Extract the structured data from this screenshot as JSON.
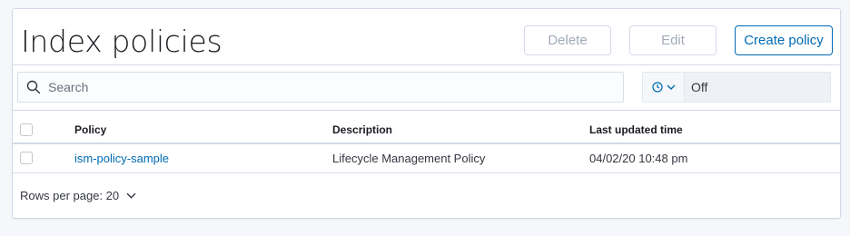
{
  "header": {
    "title": "Index policies",
    "delete_label": "Delete",
    "edit_label": "Edit",
    "create_label": "Create policy"
  },
  "search": {
    "placeholder": "Search",
    "value": ""
  },
  "refresh": {
    "icon": "clock-icon",
    "value": "Off"
  },
  "table": {
    "columns": [
      "Policy",
      "Description",
      "Last updated time"
    ],
    "rows": [
      {
        "policy": "ism-policy-sample",
        "description": "Lifecycle Management Policy",
        "last_updated": "04/02/20 10:48 pm",
        "selected": false
      }
    ]
  },
  "pagination": {
    "rows_per_page_label": "Rows per page: 20"
  },
  "colors": {
    "accent": "#006bb4",
    "border": "#d3dae6",
    "disabled_text": "#a2abba",
    "background": "#f5f7fa"
  }
}
